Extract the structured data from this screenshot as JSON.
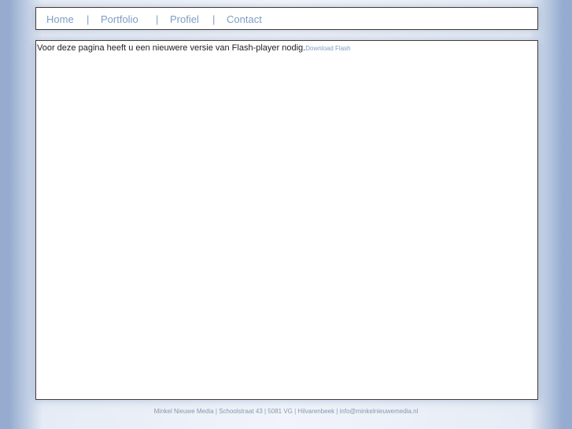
{
  "nav": {
    "items": [
      {
        "label": "Home"
      },
      {
        "label": "Portfolio"
      },
      {
        "label": "Profiel"
      },
      {
        "label": "Contact"
      }
    ],
    "separator": "|"
  },
  "content": {
    "flash_message": "Voor deze pagina heeft u een nieuwere versie van Flash-player nodig.",
    "flash_link_label": "Download Flash"
  },
  "footer": {
    "text": "Minkel Nieuwe Media | Schoolstraat 43 | 5081 VG | Hilvarenbeek | info@minkelnieuwemedia.nl"
  },
  "colors": {
    "page_background": "#95acd0",
    "nav_link": "#7e9ec3",
    "border": "#4a3a32"
  }
}
